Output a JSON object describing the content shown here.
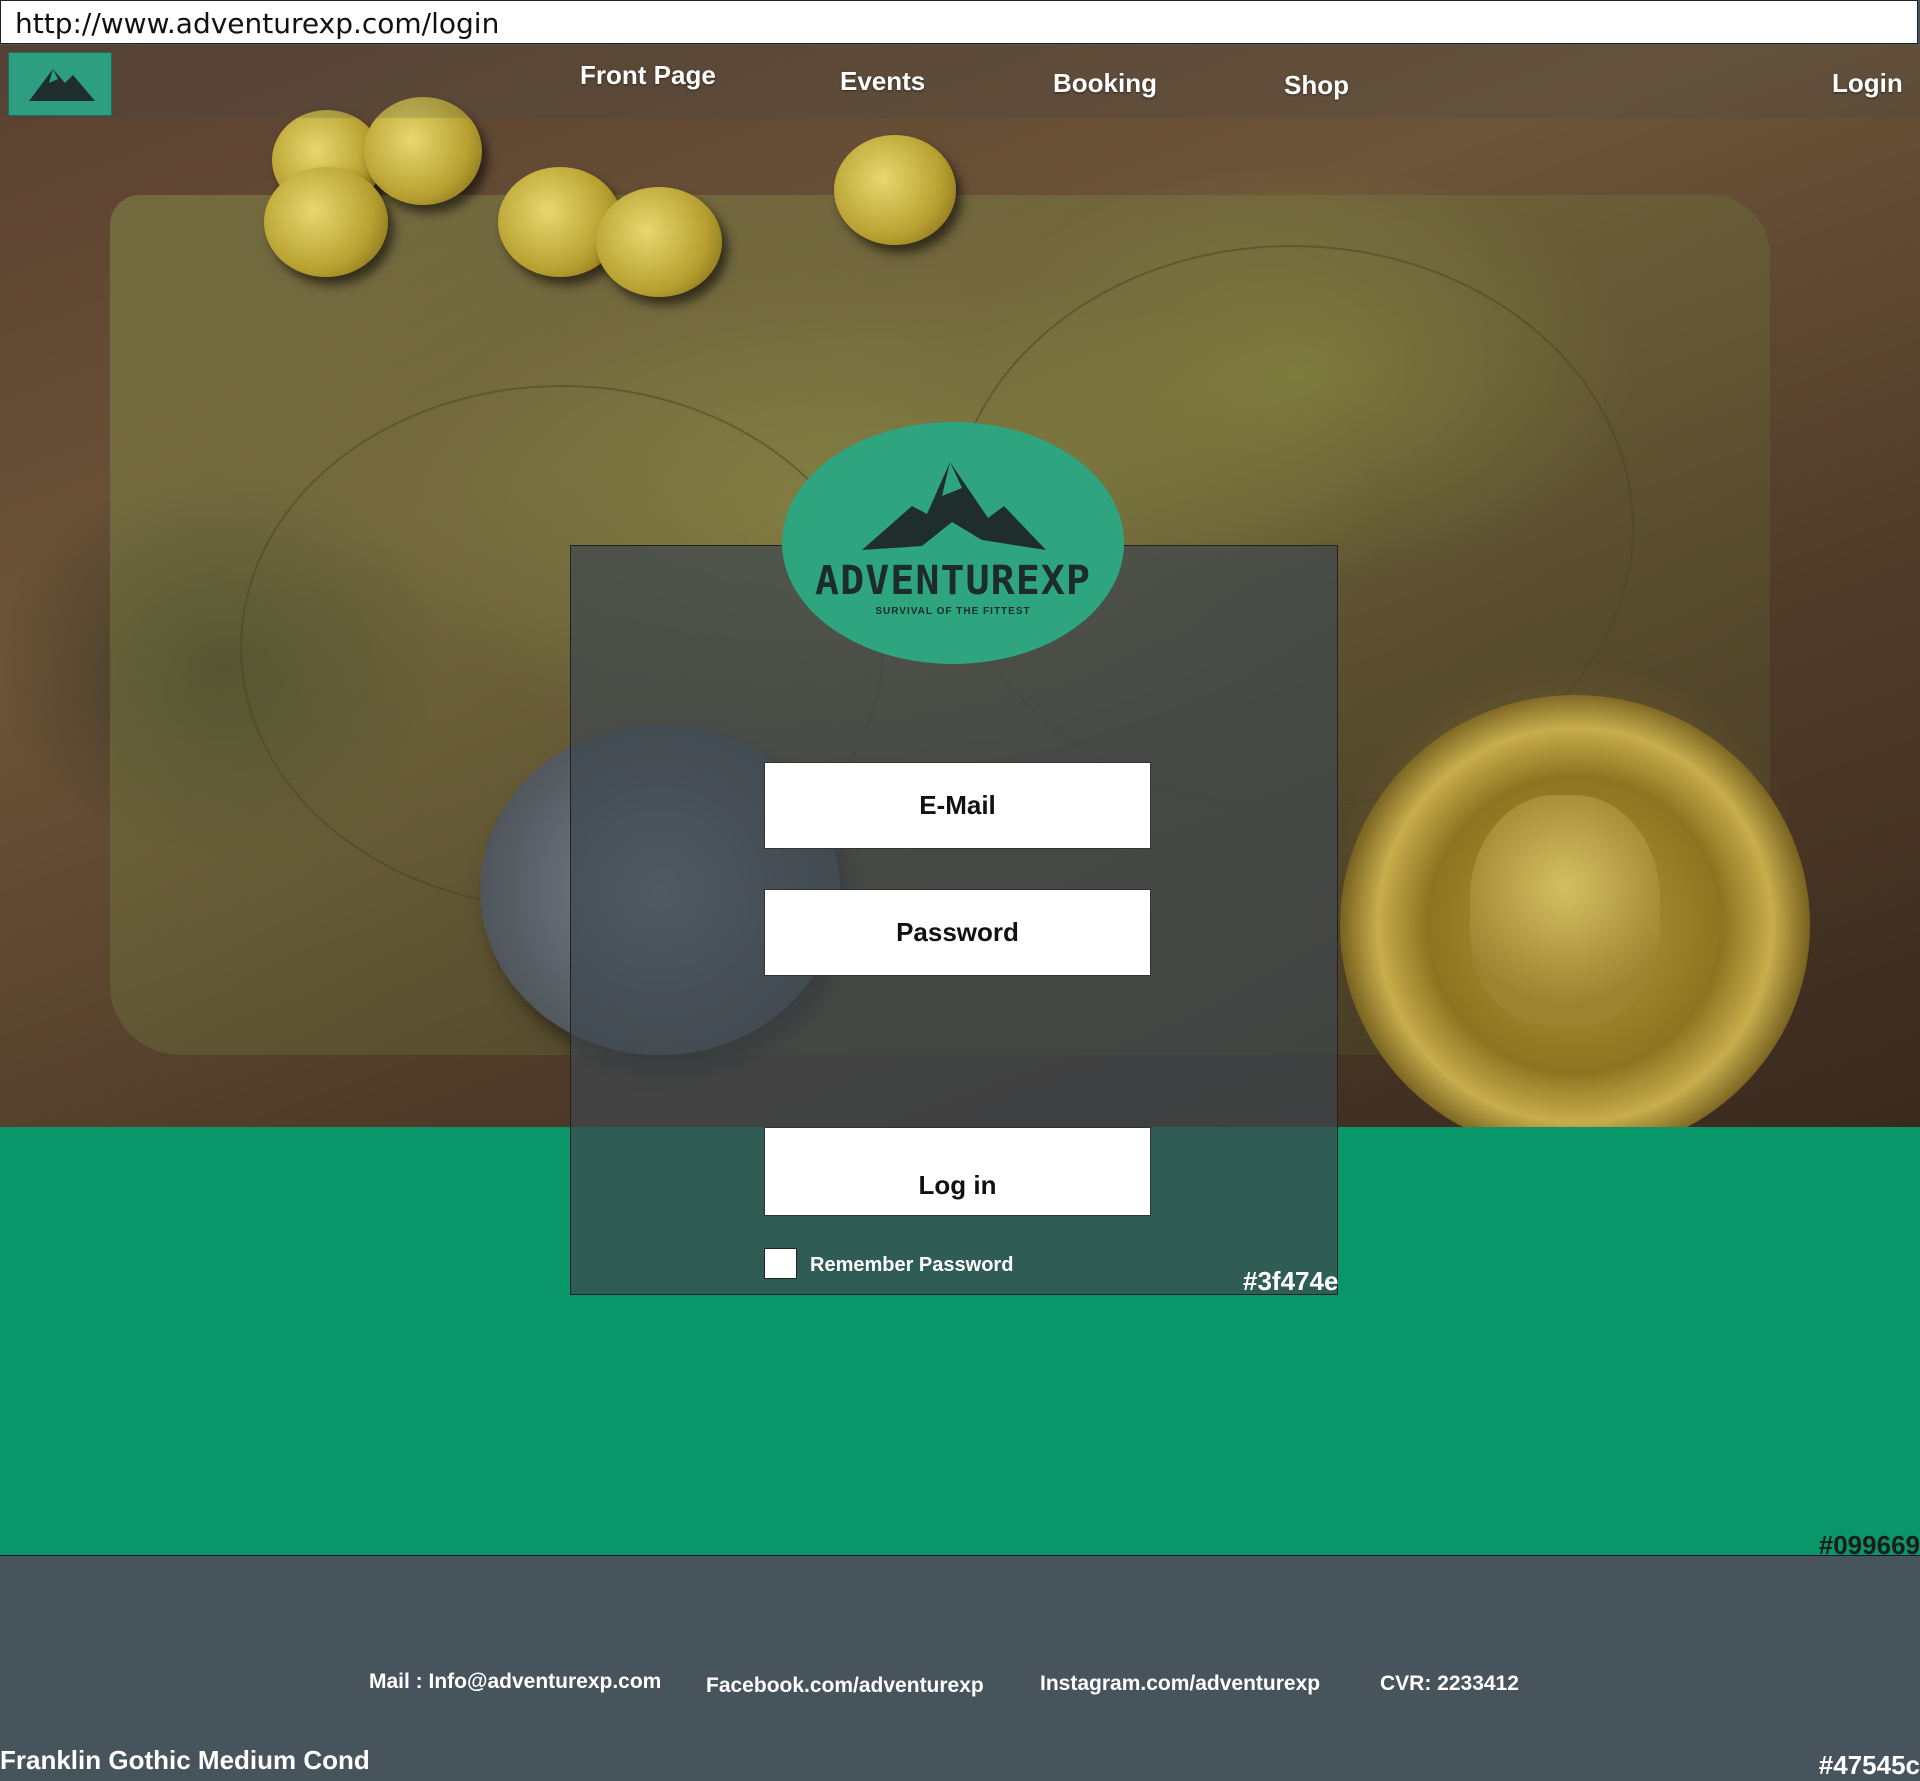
{
  "browser": {
    "url": "http://www.adventurexp.com/login"
  },
  "nav": {
    "items": [
      "Front Page",
      "Events",
      "Booking",
      "Shop"
    ],
    "login": "Login"
  },
  "logo": {
    "name": "ADVENTUREXP",
    "tagline": "SURVIVAL OF THE FITTEST"
  },
  "form": {
    "email_placeholder": "E-Mail",
    "password_placeholder": "Password",
    "login_label": "Log in",
    "remember_label": "Remember Password",
    "panel_color_note": "#3f474e"
  },
  "band": {
    "color_note": "#099669"
  },
  "footer": {
    "mail": "Mail : Info@adventurexp.com",
    "facebook": "Facebook.com/adventurexp",
    "instagram": "Instagram.com/adventurexp",
    "cvr": "CVR: 2233412",
    "font_note": "Franklin Gothic Medium Cond",
    "color_note": "#47545c"
  },
  "colors": {
    "accent": "#2ea57f",
    "band": "#099669",
    "panel": "#3f474e",
    "footer": "#47545c"
  }
}
